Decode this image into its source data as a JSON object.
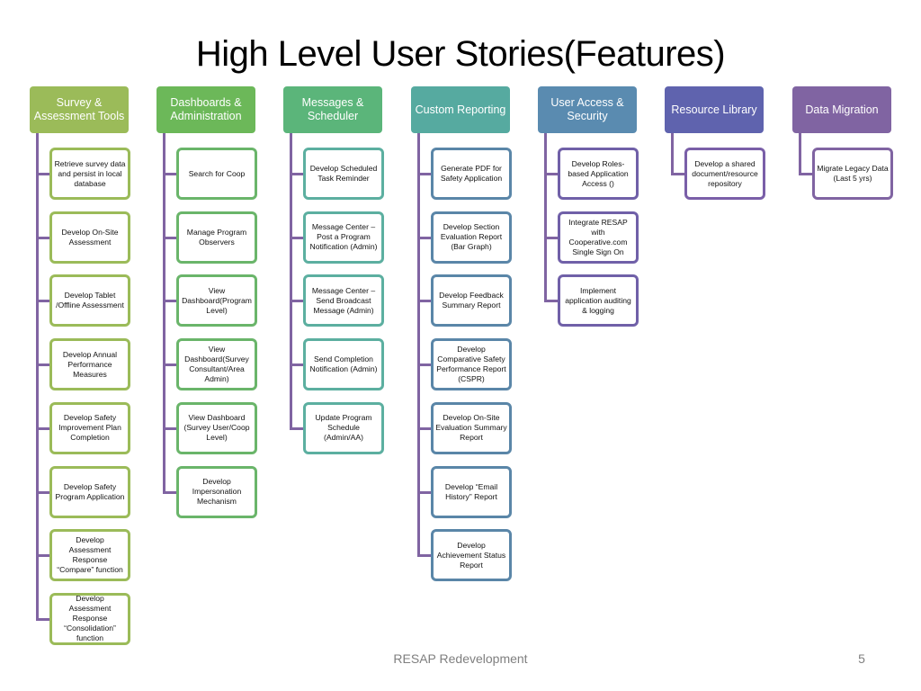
{
  "title": "High Level User Stories(Features)",
  "footer": {
    "text": "RESAP Redevelopment",
    "page_number": "5"
  },
  "connector_color": "#8064A2",
  "columns": [
    {
      "header": "Survey & Assessment Tools",
      "color": "#9BBB59",
      "card_border": "#9BBB59",
      "items": [
        "Retrieve survey data and persist in local database",
        "Develop On-Site Assessment",
        "Develop Tablet /Offline Assessment",
        "Develop Annual Performance Measures",
        "Develop Safety Improvement Plan Completion",
        "Develop Safety Program Application",
        "Develop Assessment Response “Compare” function",
        "Develop Assessment Response “Consolidation” function"
      ]
    },
    {
      "header": "Dashboards & Administration",
      "color": "#6CB859",
      "card_border": "#6AB56A",
      "items": [
        "Search for Coop",
        "Manage Program Observers",
        "View Dashboard(Program Level)",
        "View Dashboard(Survey Consultant/Area Admin)",
        "View Dashboard (Survey User/Coop Level)",
        "Develop Impersonation Mechanism"
      ]
    },
    {
      "header": "Messages & Scheduler",
      "color": "#5BB57A",
      "card_border": "#5CAFA0",
      "items": [
        "Develop Scheduled Task Reminder",
        "Message Center – Post a Program Notification (Admin)",
        "Message Center – Send Broadcast Message (Admin)",
        "Send Completion Notification (Admin)",
        "Update Program Schedule (Admin/AA)"
      ]
    },
    {
      "header": "Custom Reporting",
      "color": "#56AAA0",
      "card_border": "#5A86A8",
      "items": [
        "Generate PDF for Safety Application",
        "Develop Section Evaluation Report (Bar Graph)",
        "Develop Feedback Summary Report",
        "Develop Comparative Safety Performance Report (CSPR)",
        "Develop On-Site Evaluation Summary Report",
        "Develop “Email History” Report",
        "Develop Achievement Status Report"
      ]
    },
    {
      "header": "User Access & Security",
      "color": "#5A8BB0",
      "card_border": "#7060A8",
      "items": [
        "Develop Roles-based Application Access ()",
        "Integrate RESAP with Cooperative.com Single Sign On",
        "Implement application auditing & logging"
      ]
    },
    {
      "header": "Resource Library",
      "color": "#5F63AE",
      "card_border": "#7A5FA8",
      "items": [
        "Develop a shared document/resource repository"
      ]
    },
    {
      "header": "Data Migration",
      "color": "#8064A2",
      "card_border": "#8064A2",
      "items": [
        "Migrate Legacy Data (Last 5 yrs)"
      ]
    }
  ]
}
